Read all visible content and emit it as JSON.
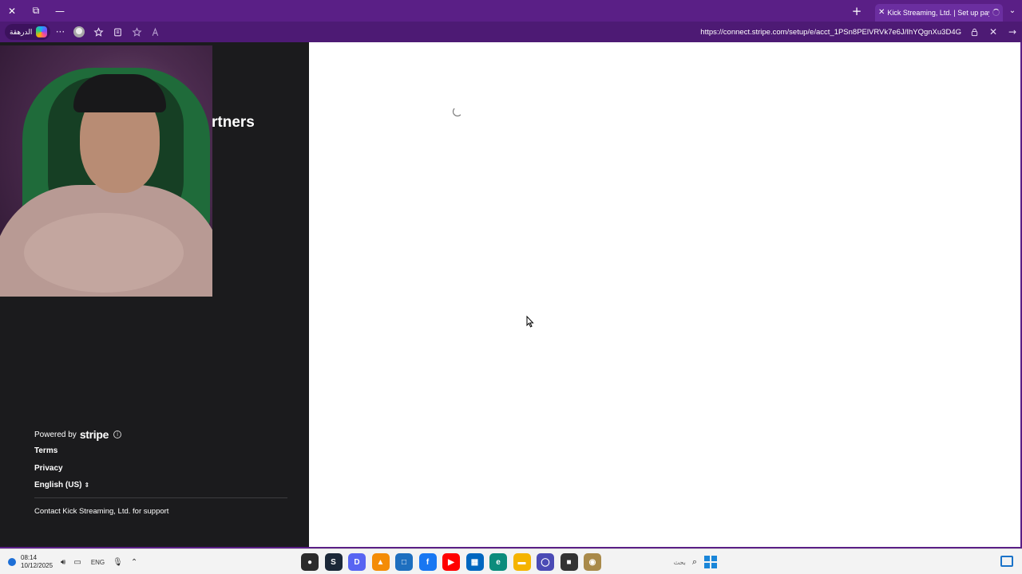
{
  "browser": {
    "window_controls": {
      "close": "✕",
      "restore": "⧉",
      "minimize": "—"
    },
    "new_tab": "+",
    "active_tab": {
      "close": "✕",
      "title": "Kick Streaming, Ltd. | Set up paym"
    },
    "tabs_menu": "⌄",
    "shopping_pill": "الدرهقة",
    "more": "···",
    "url": "https://connect.stripe.com/setup/e/acct_1PSn8PElVRVk7e6J/IhYQgnXu3D4G",
    "close_sidebar": "✕",
    "go_forward": "→"
  },
  "page": {
    "heading_fragment": "rtners",
    "powered_by": "Powered by",
    "brand": "stripe",
    "info_icon": "i",
    "terms": "Terms",
    "privacy": "Privacy",
    "language": "English (US)",
    "language_chev": "⇕",
    "contact": "Contact Kick Streaming, Ltd. for support"
  },
  "taskbar": {
    "time": "08:14",
    "date": "10/12/2025",
    "lang": "ENG",
    "search_placeholder": "بحث",
    "apps": [
      {
        "name": "app-recorder",
        "label": "●",
        "color": "#2b2b2b"
      },
      {
        "name": "app-steam",
        "label": "S",
        "color": "#1b2838"
      },
      {
        "name": "app-discord",
        "label": "D",
        "color": "#5865f2"
      },
      {
        "name": "app-vlc",
        "label": "▲",
        "color": "#f48c06"
      },
      {
        "name": "app-tool",
        "label": "□",
        "color": "#1e6fbf"
      },
      {
        "name": "app-facebook",
        "label": "f",
        "color": "#1877f2"
      },
      {
        "name": "app-youtube",
        "label": "▶",
        "color": "#ff0000"
      },
      {
        "name": "app-store",
        "label": "▦",
        "color": "#0067c0"
      },
      {
        "name": "app-edge",
        "label": "e",
        "color": "#0c8c7c"
      },
      {
        "name": "app-files",
        "label": "▬",
        "color": "#f5b400"
      },
      {
        "name": "app-chat",
        "label": "◯",
        "color": "#4b4bb5"
      },
      {
        "name": "app-terminal",
        "label": "■",
        "color": "#333333"
      },
      {
        "name": "app-game",
        "label": "◉",
        "color": "#a98a4a"
      }
    ]
  }
}
